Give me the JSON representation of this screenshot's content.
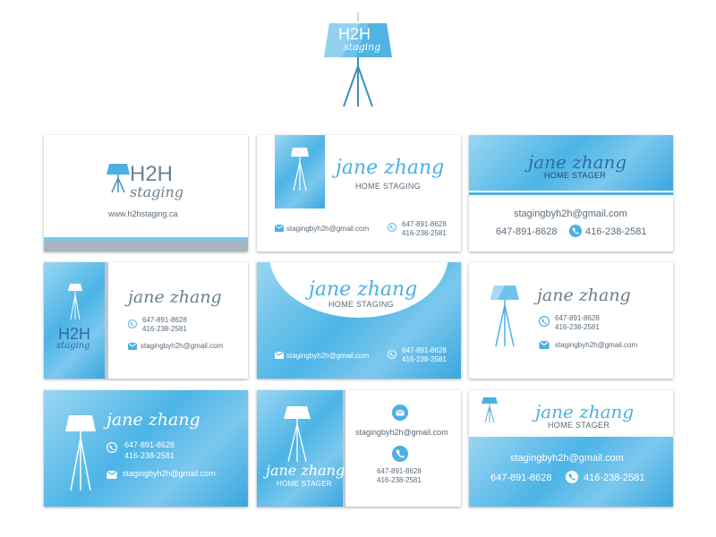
{
  "top_logo": {
    "brand": "H2H",
    "tagline": "staging"
  },
  "card1": {
    "brand": "H2H",
    "tagline": "staging",
    "website": "www.h2hstaging.ca"
  },
  "card2": {
    "name": "jane zhang",
    "title": "HOME STAGING",
    "email": "stagingbyh2h@gmail.com",
    "phone1": "647-891-8628",
    "phone2": "416-238-2581"
  },
  "card3": {
    "name": "jane zhang",
    "title": "HOME STAGER",
    "email": "stagingbyh2h@gmail.com",
    "phone1": "647-891-8628",
    "phone2": "416-238-2581"
  },
  "card4": {
    "brand": "H2H",
    "tagline": "staging",
    "name": "jane zhang",
    "phone1": "647-891-8628",
    "phone2": "416-238-2581",
    "email": "stagingbyh2h@gmail.com"
  },
  "card5": {
    "name": "jane zhang",
    "title": "HOME STAGING",
    "email": "stagingbyh2h@gmail.com",
    "phone1": "647-891-8628",
    "phone2": "416-238-2581"
  },
  "card6": {
    "name": "jane zhang",
    "phone1": "647-891-8628",
    "phone2": "416-238-2581",
    "email": "stagingbyh2h@gmail.com"
  },
  "card7": {
    "name": "jane zhang",
    "phone1": "647-891-8628",
    "phone2": "416-238-2581",
    "email": "stagingbyh2h@gmail.com"
  },
  "card8": {
    "name": "jane zhang",
    "title": "HOME STAGER",
    "email": "stagingbyh2h@gmail.com",
    "phone1": "647-891-8628",
    "phone2": "416-238-2581"
  },
  "card9": {
    "name": "jane zhang",
    "title": "HOME STAGER",
    "email": "stagingbyh2h@gmail.com",
    "phone1": "647-891-8628",
    "phone2": "416-238-2581"
  },
  "colors": {
    "accent": "#4cb0e2",
    "light": "#9ad6f2",
    "text": "#5a6a78"
  },
  "icons": [
    "lamp-icon",
    "phone-icon",
    "mail-icon"
  ]
}
